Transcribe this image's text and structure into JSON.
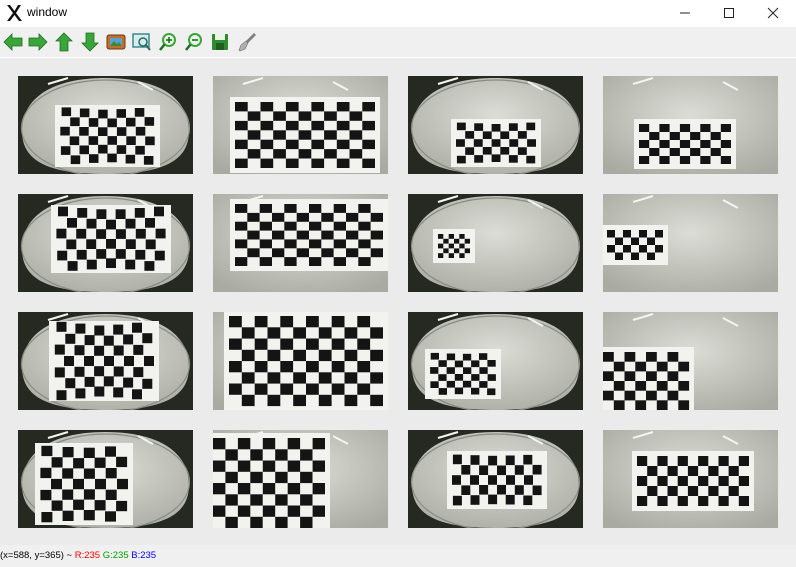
{
  "window": {
    "title": "window",
    "app_icon": "x-app-icon",
    "controls": [
      {
        "name": "minimize-icon"
      },
      {
        "name": "maximize-icon"
      },
      {
        "name": "close-icon"
      }
    ]
  },
  "toolbar": {
    "buttons": [
      {
        "name": "pan-left-button",
        "icon": "arrow-left-icon",
        "color": "#3aa53a"
      },
      {
        "name": "pan-right-button",
        "icon": "arrow-right-icon",
        "color": "#3aa53a"
      },
      {
        "name": "pan-up-button",
        "icon": "arrow-up-icon",
        "color": "#3aa53a"
      },
      {
        "name": "pan-down-button",
        "icon": "arrow-down-icon",
        "color": "#3aa53a"
      },
      {
        "name": "zoom-reset-button",
        "icon": "image-icon",
        "color": "#c0702a"
      },
      {
        "name": "zoom-fit-button",
        "icon": "zoom-window-icon",
        "color": "#3a8a8a"
      },
      {
        "name": "zoom-in-button",
        "icon": "zoom-in-icon",
        "color": "#3aa53a"
      },
      {
        "name": "zoom-out-button",
        "icon": "zoom-out-icon",
        "color": "#3aa53a"
      },
      {
        "name": "save-button",
        "icon": "save-icon",
        "color": "#2e8b2e"
      },
      {
        "name": "properties-button",
        "icon": "brush-icon",
        "color": "#808080"
      }
    ]
  },
  "gallery": {
    "rows": 4,
    "cols": 4,
    "images": [
      {
        "name": "thumb-1",
        "board": "fisheye-center",
        "dark_edge": true
      },
      {
        "name": "thumb-2",
        "board": "flat-large",
        "dark_edge": false
      },
      {
        "name": "thumb-3",
        "board": "fisheye-small",
        "dark_edge": true
      },
      {
        "name": "thumb-4",
        "board": "flat-small",
        "dark_edge": false
      },
      {
        "name": "thumb-5",
        "board": "fisheye-wide",
        "dark_edge": true
      },
      {
        "name": "thumb-6",
        "board": "flat-perspective",
        "dark_edge": false
      },
      {
        "name": "thumb-7",
        "board": "fisheye-tiny-left",
        "dark_edge": true
      },
      {
        "name": "thumb-8",
        "board": "flat-left",
        "dark_edge": false
      },
      {
        "name": "thumb-9",
        "board": "fisheye-large",
        "dark_edge": true
      },
      {
        "name": "thumb-10",
        "board": "flat-full",
        "dark_edge": false
      },
      {
        "name": "thumb-11",
        "board": "fisheye-skew-left",
        "dark_edge": true
      },
      {
        "name": "thumb-12",
        "board": "flat-left-crop",
        "dark_edge": false
      },
      {
        "name": "thumb-13",
        "board": "fisheye-left-big",
        "dark_edge": true
      },
      {
        "name": "thumb-14",
        "board": "flat-left-fill",
        "dark_edge": false
      },
      {
        "name": "thumb-15",
        "board": "fisheye-center-mid",
        "dark_edge": true
      },
      {
        "name": "thumb-16",
        "board": "flat-right-mid",
        "dark_edge": false
      }
    ]
  },
  "status": {
    "coords": "(x=588, y=365) ~ ",
    "r": "R:235",
    "g": "G:235",
    "b": "B:235"
  }
}
